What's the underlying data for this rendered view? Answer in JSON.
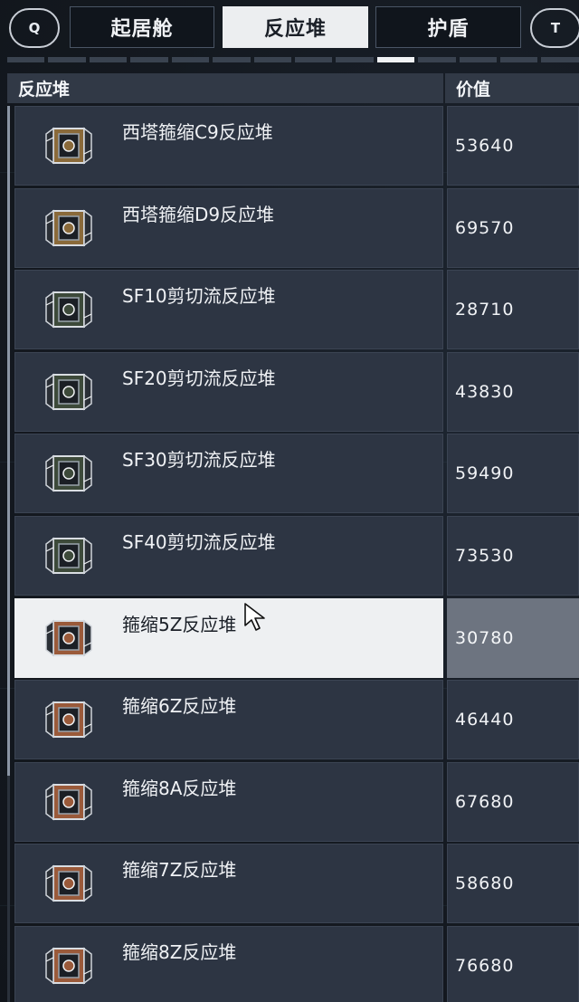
{
  "nav": {
    "left_key": "Q",
    "right_key": "T",
    "tabs": [
      {
        "label": "起居舱",
        "active": false
      },
      {
        "label": "反应堆",
        "active": true
      },
      {
        "label": "护盾",
        "active": false
      }
    ]
  },
  "table": {
    "col_name": "反应堆",
    "col_value": "价值",
    "rows": [
      {
        "name": "西塔箍缩C9反应堆",
        "value": "53640",
        "icon": "reactor-icon-gold",
        "selected": false
      },
      {
        "name": "西塔箍缩D9反应堆",
        "value": "69570",
        "icon": "reactor-icon-gold",
        "selected": false
      },
      {
        "name": "SF10剪切流反应堆",
        "value": "28710",
        "icon": "reactor-icon-green",
        "selected": false
      },
      {
        "name": "SF20剪切流反应堆",
        "value": "43830",
        "icon": "reactor-icon-green",
        "selected": false
      },
      {
        "name": "SF30剪切流反应堆",
        "value": "59490",
        "icon": "reactor-icon-green",
        "selected": false
      },
      {
        "name": "SF40剪切流反应堆",
        "value": "73530",
        "icon": "reactor-icon-green",
        "selected": false
      },
      {
        "name": "箍缩5Z反应堆",
        "value": "30780",
        "icon": "reactor-icon-copper",
        "selected": true
      },
      {
        "name": "箍缩6Z反应堆",
        "value": "46440",
        "icon": "reactor-icon-copper",
        "selected": false
      },
      {
        "name": "箍缩8A反应堆",
        "value": "67680",
        "icon": "reactor-icon-copper",
        "selected": false
      },
      {
        "name": "箍缩7Z反应堆",
        "value": "58680",
        "icon": "reactor-icon-copper",
        "selected": false
      },
      {
        "name": "箍缩8Z反应堆",
        "value": "76680",
        "icon": "reactor-icon-copper",
        "selected": false
      }
    ]
  },
  "pager": {
    "count": 14,
    "active_index": 9
  },
  "colors": {
    "gold": "#8a6a3a",
    "green": "#3d4a3a",
    "copper": "#9a5a3a"
  }
}
